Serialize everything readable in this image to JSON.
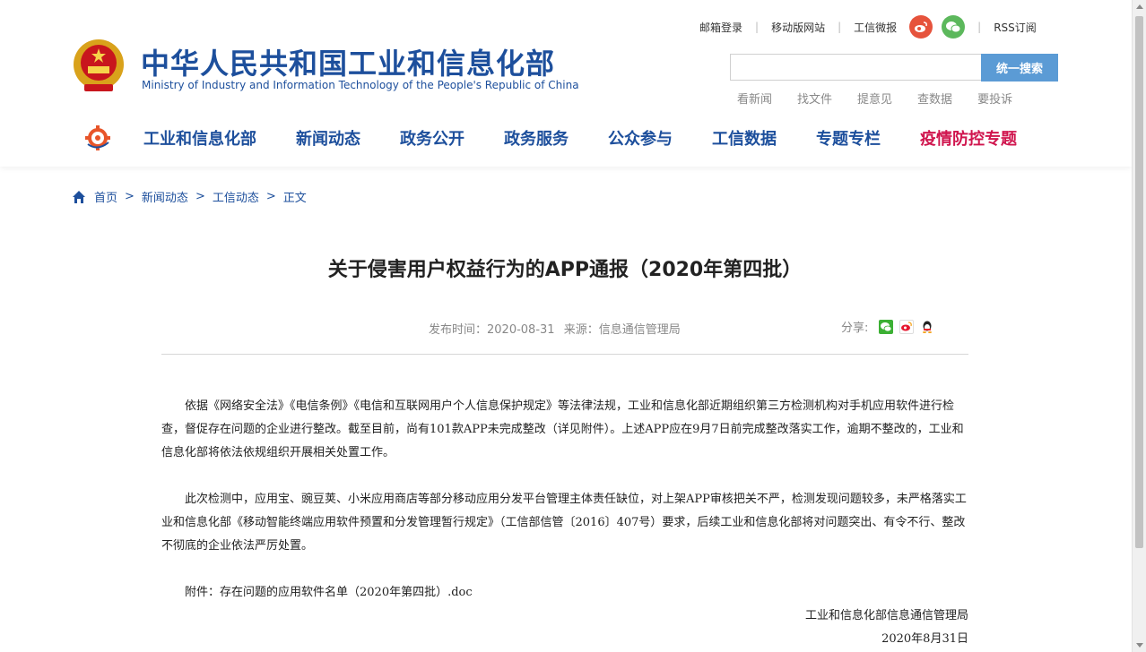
{
  "header": {
    "title_cn": "中华人民共和国工业和信息化部",
    "title_en": "Ministry of Industry and Information Technology of the People's Republic of China",
    "emblem_icon": "national-emblem-icon"
  },
  "toplinks": {
    "mail_login": "邮箱登录",
    "mobile_site": "移动版网站",
    "weibo_label": "工信微报",
    "rss": "RSS订阅"
  },
  "search": {
    "placeholder": "",
    "button_label": "统一搜索"
  },
  "quick_links": [
    "看新闻",
    "找文件",
    "提意见",
    "查数据",
    "要投诉"
  ],
  "nav": {
    "items": [
      "工业和信息化部",
      "新闻动态",
      "政务公开",
      "政务服务",
      "公众参与",
      "工信数据",
      "专题专栏",
      "疫情防控专题"
    ],
    "hot_color": "#d0154e",
    "primary_color": "#1d4f9c"
  },
  "breadcrumb": {
    "items": [
      "首页",
      "新闻动态",
      "工信动态",
      "正文"
    ],
    "separator": ">"
  },
  "article": {
    "title": "关于侵害用户权益行为的APP通报（2020年第四批）",
    "published": "发布时间：2020-08-31",
    "source": "来源：信息通信管理局",
    "share_label": "分享:",
    "paragraphs": [
      "依据《网络安全法》《电信条例》《电信和互联网用户个人信息保护规定》等法律法规，工业和信息化部近期组织第三方检测机构对手机应用软件进行检查，督促存在问题的企业进行整改。截至目前，尚有101款APP未完成整改（详见附件）。上述APP应在9月7日前完成整改落实工作，逾期不整改的，工业和信息化部将依法依规组织开展相关处置工作。",
      "此次检测中，应用宝、豌豆荚、小米应用商店等部分移动应用分发平台管理主体责任缺位，对上架APP审核把关不严，检测发现问题较多，未严格落实工业和信息化部《移动智能终端应用软件预置和分发管理暂行规定》（工信部信管〔2016〕407号）要求，后续工业和信息化部将对问题突出、有令不行、整改不彻底的企业依法严厉处置。"
    ],
    "attachment": "附件：存在问题的应用软件名单（2020年第四批）.doc",
    "signer": "工业和信息化部信息通信管理局",
    "sign_date": "2020年8月31日"
  }
}
